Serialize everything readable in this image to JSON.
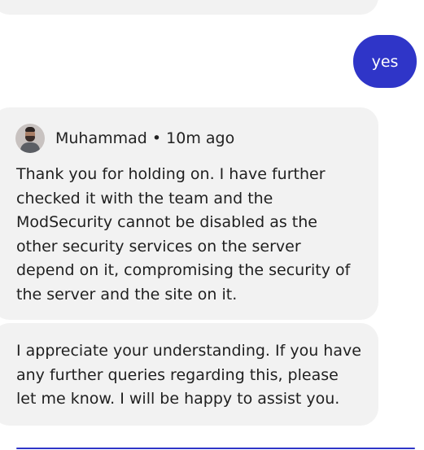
{
  "chat": {
    "user_message": "yes",
    "agent": {
      "name": "Muhammad",
      "separator": "•",
      "time_ago": "10m ago",
      "avatar_icon": "person-avatar"
    },
    "agent_messages": [
      "Thank you for holding on. I have further checked it with the team and the ModSecurity cannot be disabled as the other security services on the server depend on it, compromising the security of the server and the site on it.",
      "I appreciate your understanding. If you have any further queries regarding this, please let me know. I will be happy to assist you."
    ]
  },
  "colors": {
    "user_bubble": "#2f35c8",
    "agent_bubble": "#f2f2f2",
    "text": "#1f1f1f",
    "background": "#ffffff"
  }
}
